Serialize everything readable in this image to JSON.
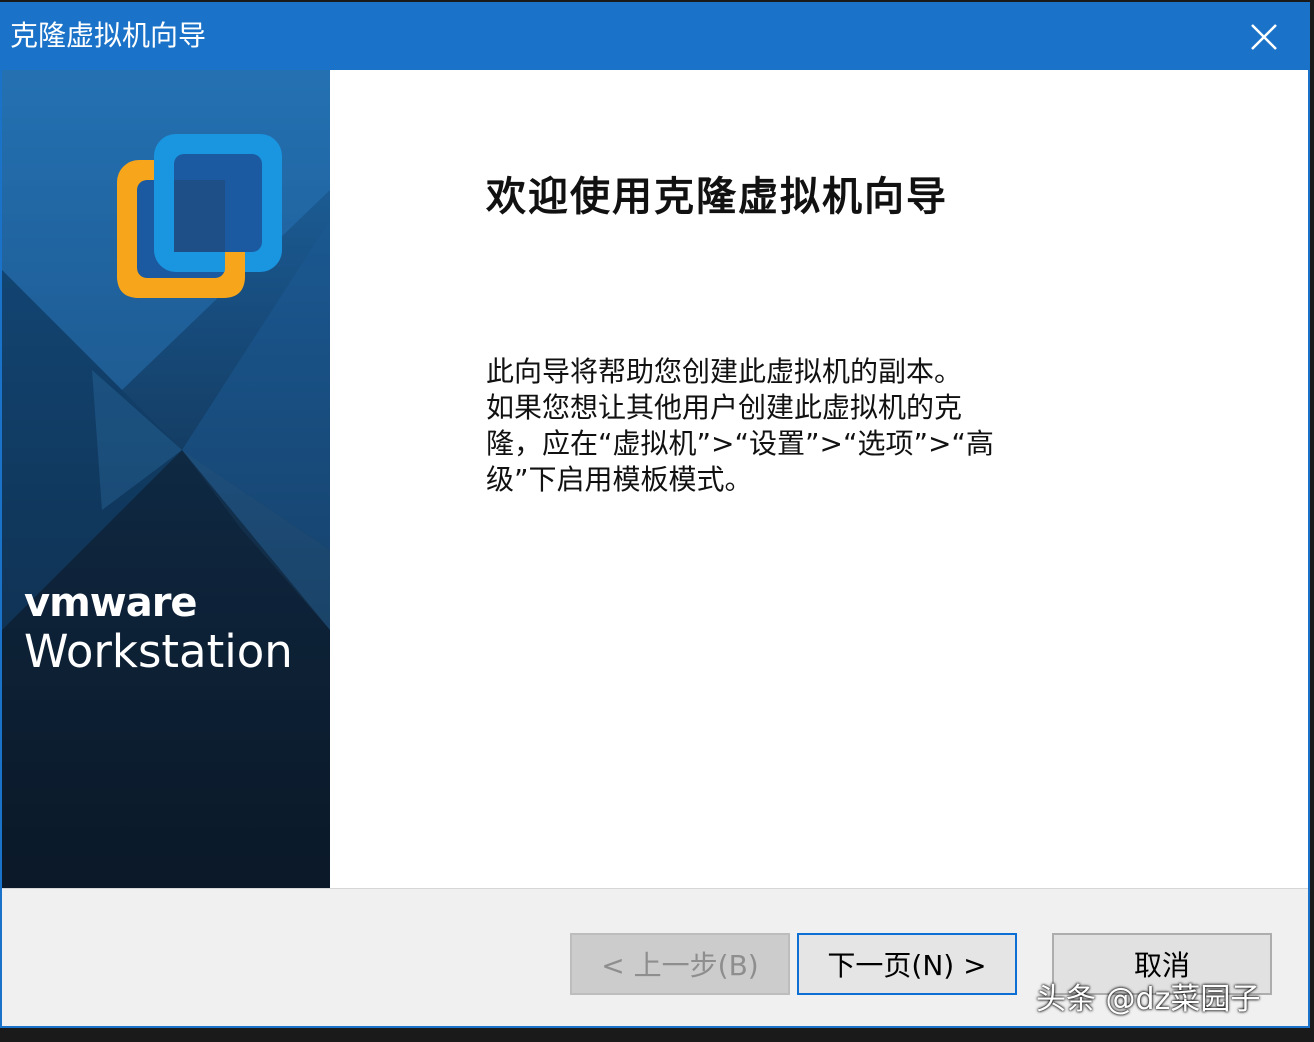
{
  "window": {
    "title": "克隆虚拟机向导",
    "accent_color": "#1a73c8"
  },
  "sidebar": {
    "brand": "vmware",
    "product": "Workstation"
  },
  "main": {
    "heading": "欢迎使用克隆虚拟机向导",
    "description_lines": [
      "此向导将帮助您创建此虚拟机的副本。",
      "如果您想让其他用户创建此虚拟机的克",
      "隆，应在“虚拟机”>“设置”>“选项”>“高",
      "级”下启用模板模式。"
    ]
  },
  "footer": {
    "back_label": "< 上一步(B)",
    "next_label": "下一页(N) >",
    "cancel_label": "取消"
  },
  "watermark": "头条 @dz菜园子"
}
